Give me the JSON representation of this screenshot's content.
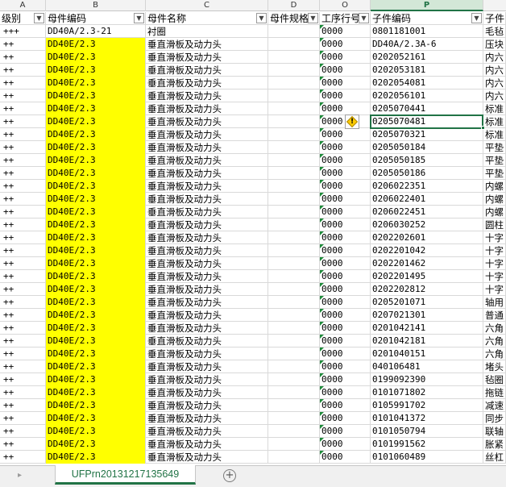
{
  "columns": [
    {
      "letter": "A",
      "active": false
    },
    {
      "letter": "B",
      "active": false
    },
    {
      "letter": "C",
      "active": false
    },
    {
      "letter": "D",
      "active": false
    },
    {
      "letter": "O",
      "active": false
    },
    {
      "letter": "P",
      "active": true
    },
    {
      "letter": "",
      "active": false
    }
  ],
  "header_row": [
    "级别",
    "母件编码",
    "母件名称",
    "母件规格",
    "工序行号",
    "子件编码",
    "子件"
  ],
  "rows": [
    {
      "level": "+++",
      "parent_code": "DD40A/2.3-21",
      "parent_name": "衬圈",
      "op": "0000",
      "child_code": "0801181001",
      "child_name": "毛毡",
      "yellow": false
    },
    {
      "level": "++",
      "parent_code": "DD40E/2.3",
      "parent_name": "垂直滑板及动力头",
      "op": "0000",
      "child_code": "DD40A/2.3A-6",
      "child_name": "压块",
      "yellow": true
    },
    {
      "level": "++",
      "parent_code": "DD40E/2.3",
      "parent_name": "垂直滑板及动力头",
      "op": "0000",
      "child_code": "0202052161",
      "child_name": "内六",
      "yellow": true
    },
    {
      "level": "++",
      "parent_code": "DD40E/2.3",
      "parent_name": "垂直滑板及动力头",
      "op": "0000",
      "child_code": "0202053181",
      "child_name": "内六",
      "yellow": true
    },
    {
      "level": "++",
      "parent_code": "DD40E/2.3",
      "parent_name": "垂直滑板及动力头",
      "op": "0000",
      "child_code": "0202054081",
      "child_name": "内六",
      "yellow": true
    },
    {
      "level": "++",
      "parent_code": "DD40E/2.3",
      "parent_name": "垂直滑板及动力头",
      "op": "0000",
      "child_code": "0202056101",
      "child_name": "内六",
      "yellow": true
    },
    {
      "level": "++",
      "parent_code": "DD40E/2.3",
      "parent_name": "垂直滑板及动力头",
      "op": "0000",
      "child_code": "0205070441",
      "child_name": "标准",
      "yellow": true
    },
    {
      "level": "++",
      "parent_code": "DD40E/2.3",
      "parent_name": "垂直滑板及动力头",
      "op": "0000",
      "child_code": "0205070481",
      "child_name": "标准",
      "yellow": true
    },
    {
      "level": "++",
      "parent_code": "DD40E/2.3",
      "parent_name": "垂直滑板及动力头",
      "op": "0000",
      "child_code": "0205070321",
      "child_name": "标准",
      "yellow": true
    },
    {
      "level": "++",
      "parent_code": "DD40E/2.3",
      "parent_name": "垂直滑板及动力头",
      "op": "0000",
      "child_code": "0205050184",
      "child_name": "平垫",
      "yellow": true
    },
    {
      "level": "++",
      "parent_code": "DD40E/2.3",
      "parent_name": "垂直滑板及动力头",
      "op": "0000",
      "child_code": "0205050185",
      "child_name": "平垫",
      "yellow": true
    },
    {
      "level": "++",
      "parent_code": "DD40E/2.3",
      "parent_name": "垂直滑板及动力头",
      "op": "0000",
      "child_code": "0205050186",
      "child_name": "平垫",
      "yellow": true
    },
    {
      "level": "++",
      "parent_code": "DD40E/2.3",
      "parent_name": "垂直滑板及动力头",
      "op": "0000",
      "child_code": "0206022351",
      "child_name": "内螺",
      "yellow": true
    },
    {
      "level": "++",
      "parent_code": "DD40E/2.3",
      "parent_name": "垂直滑板及动力头",
      "op": "0000",
      "child_code": "0206022401",
      "child_name": "内螺",
      "yellow": true
    },
    {
      "level": "++",
      "parent_code": "DD40E/2.3",
      "parent_name": "垂直滑板及动力头",
      "op": "0000",
      "child_code": "0206022451",
      "child_name": "内螺",
      "yellow": true
    },
    {
      "level": "++",
      "parent_code": "DD40E/2.3",
      "parent_name": "垂直滑板及动力头",
      "op": "0000",
      "child_code": "0206030252",
      "child_name": "圆柱",
      "yellow": true
    },
    {
      "level": "++",
      "parent_code": "DD40E/2.3",
      "parent_name": "垂直滑板及动力头",
      "op": "0000",
      "child_code": "0202202601",
      "child_name": "十字",
      "yellow": true
    },
    {
      "level": "++",
      "parent_code": "DD40E/2.3",
      "parent_name": "垂直滑板及动力头",
      "op": "0000",
      "child_code": "0202201042",
      "child_name": "十字",
      "yellow": true
    },
    {
      "level": "++",
      "parent_code": "DD40E/2.3",
      "parent_name": "垂直滑板及动力头",
      "op": "0000",
      "child_code": "0202201462",
      "child_name": "十字",
      "yellow": true
    },
    {
      "level": "++",
      "parent_code": "DD40E/2.3",
      "parent_name": "垂直滑板及动力头",
      "op": "0000",
      "child_code": "0202201495",
      "child_name": "十字",
      "yellow": true
    },
    {
      "level": "++",
      "parent_code": "DD40E/2.3",
      "parent_name": "垂直滑板及动力头",
      "op": "0000",
      "child_code": "0202202812",
      "child_name": "十字",
      "yellow": true
    },
    {
      "level": "++",
      "parent_code": "DD40E/2.3",
      "parent_name": "垂直滑板及动力头",
      "op": "0000",
      "child_code": "0205201071",
      "child_name": "轴用",
      "yellow": true
    },
    {
      "level": "++",
      "parent_code": "DD40E/2.3",
      "parent_name": "垂直滑板及动力头",
      "op": "0000",
      "child_code": "0207021301",
      "child_name": "普通",
      "yellow": true
    },
    {
      "level": "++",
      "parent_code": "DD40E/2.3",
      "parent_name": "垂直滑板及动力头",
      "op": "0000",
      "child_code": "0201042141",
      "child_name": "六角",
      "yellow": true
    },
    {
      "level": "++",
      "parent_code": "DD40E/2.3",
      "parent_name": "垂直滑板及动力头",
      "op": "0000",
      "child_code": "0201042181",
      "child_name": "六角",
      "yellow": true
    },
    {
      "level": "++",
      "parent_code": "DD40E/2.3",
      "parent_name": "垂直滑板及动力头",
      "op": "0000",
      "child_code": "0201040151",
      "child_name": "六角",
      "yellow": true
    },
    {
      "level": "++",
      "parent_code": "DD40E/2.3",
      "parent_name": "垂直滑板及动力头",
      "op": "0000",
      "child_code": "040106481",
      "child_name": "堵头",
      "yellow": true
    },
    {
      "level": "++",
      "parent_code": "DD40E/2.3",
      "parent_name": "垂直滑板及动力头",
      "op": "0000",
      "child_code": "0199092390",
      "child_name": "毡圈",
      "yellow": true
    },
    {
      "level": "++",
      "parent_code": "DD40E/2.3",
      "parent_name": "垂直滑板及动力头",
      "op": "0000",
      "child_code": "0101071802",
      "child_name": "拖链",
      "yellow": true
    },
    {
      "level": "++",
      "parent_code": "DD40E/2.3",
      "parent_name": "垂直滑板及动力头",
      "op": "0000",
      "child_code": "0105991702",
      "child_name": "减速",
      "yellow": true
    },
    {
      "level": "++",
      "parent_code": "DD40E/2.3",
      "parent_name": "垂直滑板及动力头",
      "op": "0000",
      "child_code": "0101041372",
      "child_name": "同步",
      "yellow": true
    },
    {
      "level": "++",
      "parent_code": "DD40E/2.3",
      "parent_name": "垂直滑板及动力头",
      "op": "0000",
      "child_code": "0101050794",
      "child_name": "联轴",
      "yellow": true
    },
    {
      "level": "++",
      "parent_code": "DD40E/2.3",
      "parent_name": "垂直滑板及动力头",
      "op": "0000",
      "child_code": "0101991562",
      "child_name": "胀紧",
      "yellow": true
    },
    {
      "level": "++",
      "parent_code": "DD40E/2.3",
      "parent_name": "垂直滑板及动力头",
      "op": "0000",
      "child_code": "0101060489",
      "child_name": "丝杠",
      "yellow": true
    }
  ],
  "selected_row_index": 7,
  "sheet_tab": "UFPrn20131217135649",
  "add_sheet_symbol": "+",
  "filter_symbol": "▼",
  "warning_symbol": "!",
  "colors": {
    "accent": "#217346",
    "highlight": "#ffff00"
  }
}
